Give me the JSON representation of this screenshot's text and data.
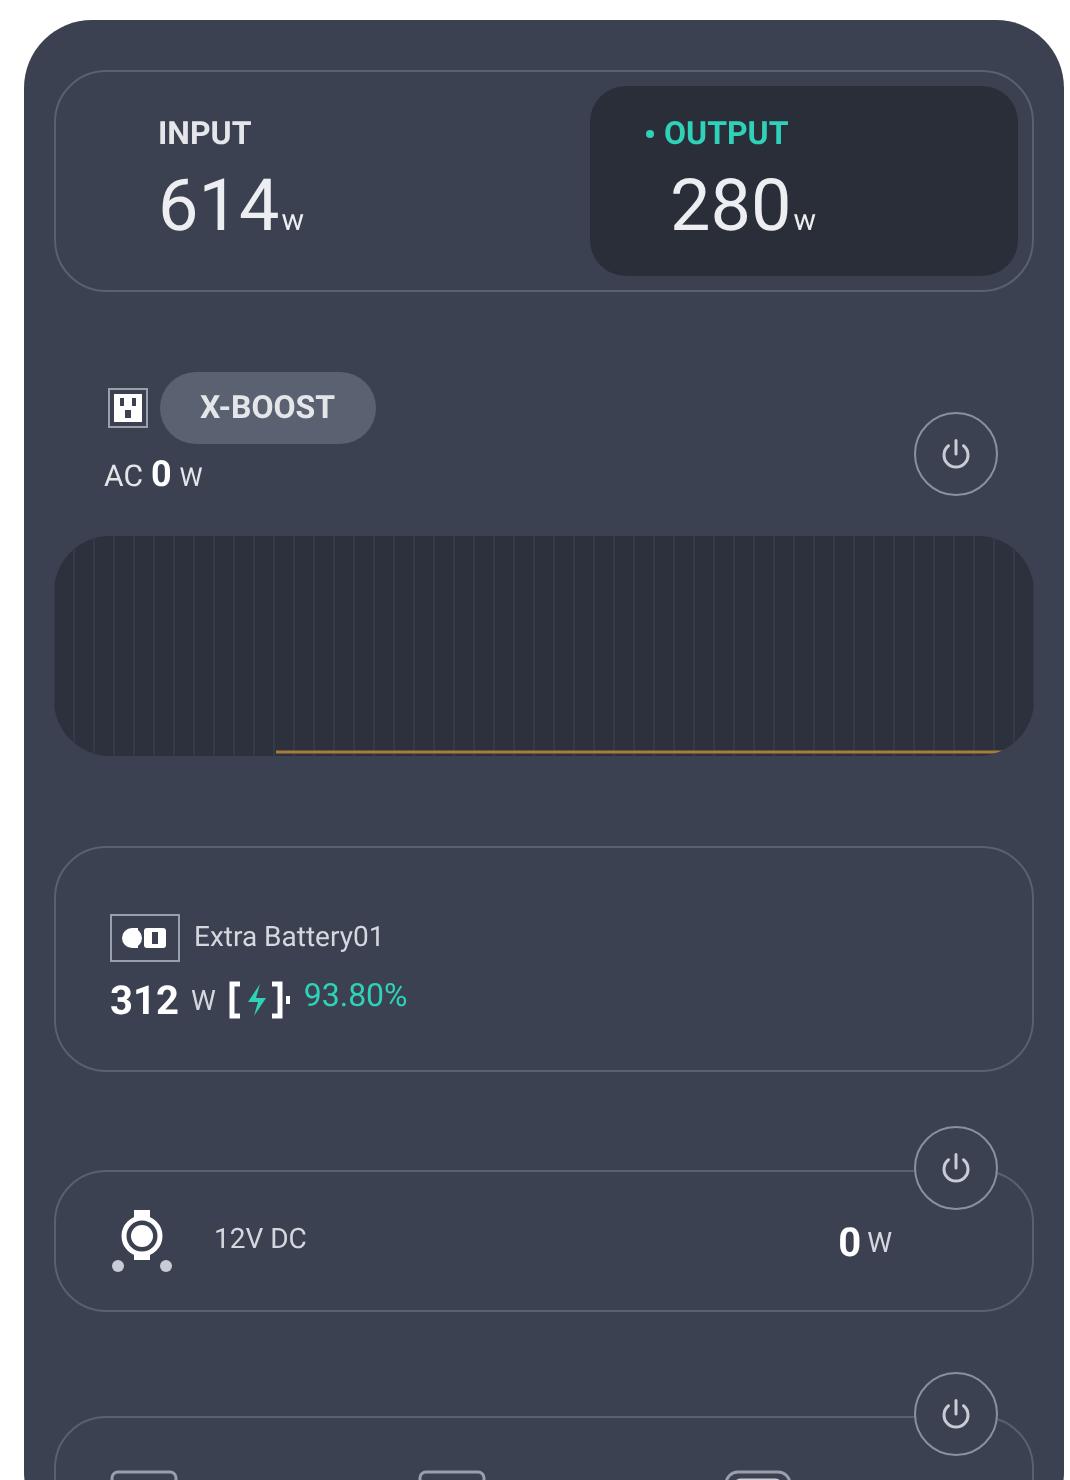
{
  "summary": [
    {
      "label": "INPUT",
      "value": "614",
      "unit": "w",
      "selected": false
    },
    {
      "label": "OUTPUT",
      "value": "280",
      "unit": "w",
      "selected": true
    }
  ],
  "ac": {
    "badge": "X-BOOST",
    "label": "AC",
    "value": "0",
    "unit": "W"
  },
  "battery": {
    "name": "Extra Battery01",
    "value": "312",
    "unit": "W",
    "percent": "93.80%"
  },
  "dc": {
    "label": "12V DC",
    "value": "0",
    "unit": "W"
  },
  "usb_ports": [
    {
      "kind": "usb-a"
    },
    {
      "kind": "usb-a"
    },
    {
      "kind": "usb-c"
    }
  ]
}
